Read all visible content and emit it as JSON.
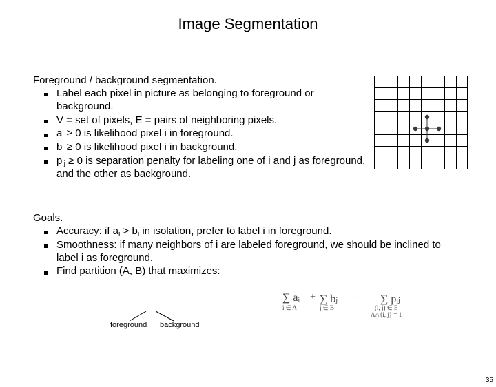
{
  "title": "Image Segmentation",
  "section1_head": "Foreground / background segmentation.",
  "s1b1": "Label each pixel in picture as belonging to foreground or background.",
  "s1b2": "V = set of pixels, E = pairs of neighboring pixels.",
  "s1b3_pre": "a",
  "s1b3_sub": "i",
  "s1b3_post": " ≥ 0 is likelihood pixel i in foreground.",
  "s1b4_pre": "b",
  "s1b4_sub": "i",
  "s1b4_post": " ≥ 0 is likelihood pixel i in background.",
  "s1b5_pre": "p",
  "s1b5_sub": "ij",
  "s1b5_post": " ≥ 0 is separation penalty for labeling one of i and j as foreground, and the other as background.",
  "section2_head": "Goals.",
  "s2b1_a": "Accuracy:  if a",
  "s2b1_sub1": "i",
  "s2b1_b": " > b",
  "s2b1_sub2": "i",
  "s2b1_c": " in isolation, prefer to label i in foreground.",
  "s2b2": "Smoothness: if many neighbors of i are labeled foreground, we should be inclined to label i as foreground.",
  "s2b3": "Find partition (A, B) that maximizes:",
  "annot_fg": "foreground",
  "annot_bg": "background",
  "formula": {
    "sum1_top": "∑ aᵢ",
    "sum1_under": "i ∈ A",
    "plus1": "+",
    "sum2_top": "∑ bⱼ",
    "sum2_under": "j ∈ B",
    "minus": "−",
    "sum3_top": "∑ pᵢⱼ",
    "sum3_under1": "(i, j) ∈ E",
    "sum3_under2": "A∩{i, j} = 1"
  },
  "page_number": "35"
}
